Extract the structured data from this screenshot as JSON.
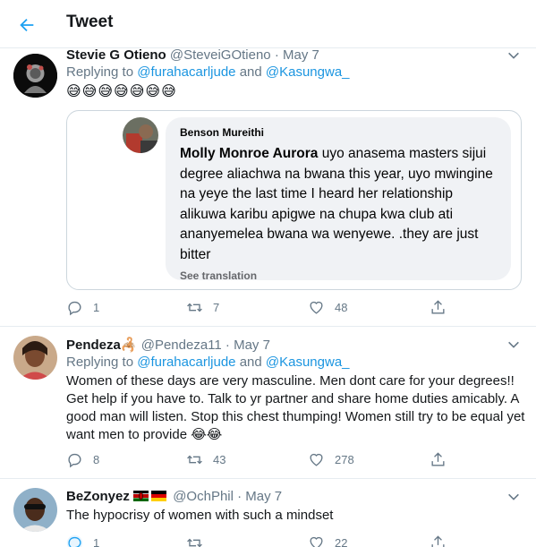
{
  "header": {
    "title": "Tweet",
    "back_icon": "arrow-left-icon"
  },
  "accent_color": "#1b95e0",
  "tweets": [
    {
      "name": "Stevie G Otieno",
      "handle": "@SteveiGOtieno",
      "separator": "·",
      "date": "May 7",
      "replying_to_label": "Replying to",
      "mention_1": "@furahacarljude",
      "and_label": "and",
      "mention_2": "@Kasungwa_",
      "emojis": "😅😅😅😅😅😅😅",
      "quote": {
        "author": "Benson Mureithi",
        "tagged_name": "Molly Monroe Aurora",
        "text": " uyo anasema masters sijui degree aliachwa na bwana this year, uyo mwingine na yeye the last time I heard her relationship alikuwa karibu apigwe na chupa kwa club ati ananyemelea bwana wa wenyewe. .they are just bitter",
        "see_translation": "See translation"
      },
      "replies": "1",
      "retweets": "7",
      "likes": "48"
    },
    {
      "name": "Pendeza",
      "name_emoji": "🦂",
      "handle": "@Pendeza11",
      "separator": "·",
      "date": "May 7",
      "replying_to_label": "Replying to",
      "mention_1": "@furahacarljude",
      "and_label": "and",
      "mention_2": "@Kasungwa_",
      "text": "Women of these days are very masculine.  Men dont care for your degrees!! Get help if you have to. Talk to yr partner and share home duties amicably. A good man will listen. Stop this chest thumping! Women still try to be equal yet want men to provide 😂😂",
      "replies": "8",
      "retweets": "43",
      "likes": "278"
    },
    {
      "name": "BeZonyez",
      "flags": [
        "kenya-flag",
        "germany-flag"
      ],
      "handle": "@OchPhil",
      "separator": "·",
      "date": "May 7",
      "text": "The hypocrisy of women with such a mindset",
      "replies": "1",
      "retweets": "",
      "likes": "22"
    }
  ]
}
